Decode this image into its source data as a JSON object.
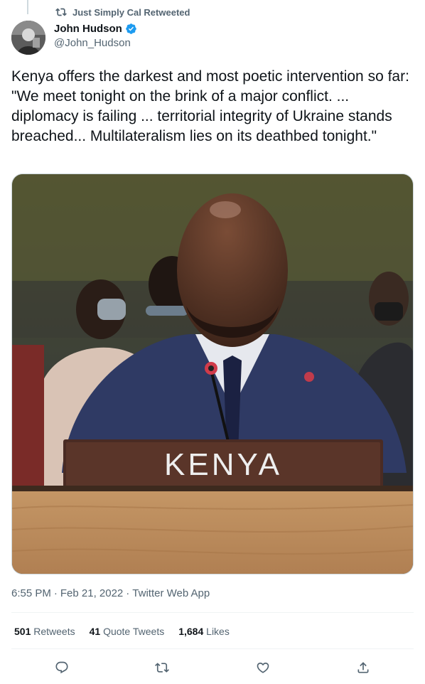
{
  "social_context": {
    "text": "Just Simply Cal Retweeted"
  },
  "author": {
    "display_name": "John Hudson",
    "handle": "@John_Hudson",
    "verified": true
  },
  "tweet": {
    "text": "Kenya offers the darkest and most poetic intervention so far: \"We meet tonight on the brink of a major conflict. ... diplomacy is failing ... territorial integrity of Ukraine stands breached... Multilateralism lies on its deathbed tonight.\""
  },
  "media": {
    "nameplate_text": "KENYA"
  },
  "meta": {
    "time": "6:55 PM",
    "date": "Feb 21, 2022",
    "source": "Twitter Web App",
    "separator": "·"
  },
  "stats": {
    "retweets": {
      "count": "501",
      "label": "Retweets"
    },
    "quote_tweets": {
      "count": "41",
      "label": "Quote Tweets"
    },
    "likes": {
      "count": "1,684",
      "label": "Likes"
    }
  },
  "actions": [
    "reply-icon",
    "retweet-icon",
    "like-icon",
    "share-icon"
  ],
  "colors": {
    "text": "#0f1419",
    "secondary": "#536471",
    "verified": "#1d9bf0",
    "divider": "#eff3f4"
  }
}
